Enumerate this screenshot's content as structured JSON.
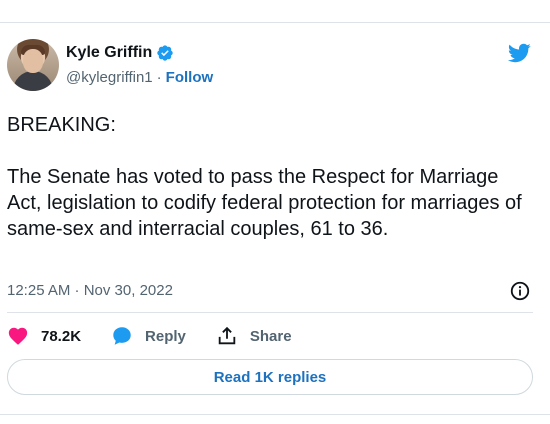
{
  "author": {
    "name": "Kyle Griffin",
    "handle": "@kylegriffin1",
    "separator": "·",
    "follow_label": "Follow"
  },
  "tweet": {
    "text": "BREAKING:\n\nThe Senate has voted to pass the Respect for Marriage Act, legislation to codify federal protection for marriages of same-sex and interracial couples, 61 to 36.",
    "timestamp": "12:25 AM · Nov 30, 2022"
  },
  "actions": {
    "like_count": "78.2K",
    "reply_label": "Reply",
    "share_label": "Share"
  },
  "replies_button": {
    "label": "Read 1K replies"
  },
  "icons": {
    "verified": "verified-badge-icon",
    "brand": "twitter-bird-icon",
    "info": "info-icon",
    "like": "heart-icon",
    "reply": "speech-bubble-icon",
    "share": "share-upload-icon"
  },
  "colors": {
    "accent": "#1d9bf0",
    "link": "#1d72bf",
    "like": "#f91880",
    "muted": "#536471",
    "text": "#0f1419"
  }
}
